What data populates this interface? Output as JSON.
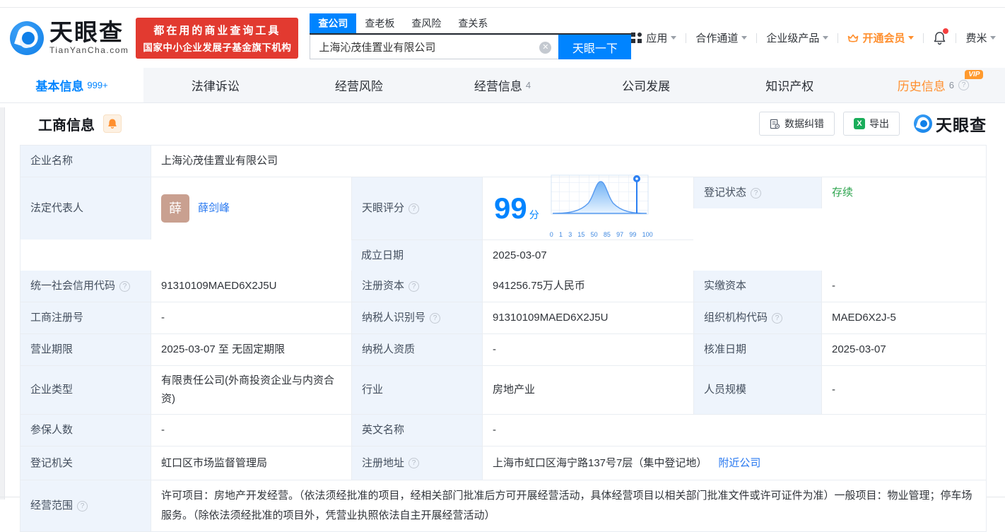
{
  "colors": {
    "accent": "#0084ff",
    "orange": "#ff8f2e",
    "green": "#2da44e",
    "promo_red": "#e23a30",
    "label_bg": "#eef4fc",
    "avatar_bg": "#c9a090"
  },
  "header": {
    "brand": "天眼查",
    "brand_domain": "TianYanCha.com",
    "promo": {
      "line1": "都在用的商业查询工具",
      "line2": "国家中小企业发展子基金旗下机构"
    },
    "search": {
      "tabs": {
        "company": "查公司",
        "boss": "查老板",
        "risk": "查风险",
        "relation": "查关系"
      },
      "value": "上海沁茂佳置业有限公司",
      "button": "天眼一下"
    },
    "nav": {
      "apps": "应用",
      "partner": "合作通道",
      "enterprise": "企业级产品",
      "vip": "开通会员",
      "user": "费米"
    }
  },
  "tabs": {
    "basic": {
      "label": "基本信息",
      "badge": "999+"
    },
    "legal": {
      "label": "法律诉讼"
    },
    "risk": {
      "label": "经营风险"
    },
    "operation": {
      "label": "经营信息",
      "badge": "4"
    },
    "development": {
      "label": "公司发展"
    },
    "ip": {
      "label": "知识产权"
    },
    "history": {
      "label": "历史信息",
      "badge": "6",
      "vip_tag": "VIP"
    }
  },
  "section": {
    "title": "工商信息",
    "correct_btn": "数据纠错",
    "export_btn": "导出",
    "brand": "天眼查"
  },
  "table": {
    "r1": {
      "label": "企业名称",
      "value": "上海沁茂佳置业有限公司"
    },
    "r2": {
      "label": "法定代表人",
      "avatar": "薛",
      "name": "薛剑峰",
      "status_label": "登记状态",
      "status_value": "存续",
      "date_label": "成立日期",
      "date_value": "2025-03-07",
      "score_label": "天眼评分"
    },
    "r3": {
      "l1": "统一社会信用代码",
      "v1": "91310109MAED6X2J5U",
      "l2": "注册资本",
      "v2": "941256.75万人民币",
      "l3": "实缴资本",
      "v3": "-"
    },
    "r4": {
      "l1": "工商注册号",
      "v1": "-",
      "l2": "纳税人识别号",
      "v2": "91310109MAED6X2J5U",
      "l3": "组织机构代码",
      "v3": "MAED6X2J-5"
    },
    "r5": {
      "l1": "营业期限",
      "v1": "2025-03-07 至 无固定期限",
      "l2": "纳税人资质",
      "v2": "-",
      "l3": "核准日期",
      "v3": "2025-03-07"
    },
    "r6": {
      "l1": "企业类型",
      "v1": "有限责任公司(外商投资企业与内资合资)",
      "l2": "行业",
      "v2": "房地产业",
      "l3": "人员规模",
      "v3": "-"
    },
    "r7": {
      "l1": "参保人数",
      "v1": "-",
      "l2": "英文名称",
      "v2": "-"
    },
    "r8": {
      "l1": "登记机关",
      "v1": "虹口区市场监督管理局",
      "l2": "注册地址",
      "v2": "上海市虹口区海宁路137号7层（集中登记地）",
      "link": "附近公司"
    },
    "r9": {
      "label": "经营范围",
      "value": "许可项目：房地产开发经营。（依法须经批准的项目，经相关部门批准后方可开展经营活动，具体经营项目以相关部门批准文件或许可证件为准）一般项目：物业管理；停车场服务。（除依法须经批准的项目外，凭营业执照依法自主开展经营活动）"
    }
  },
  "score": {
    "value": "99",
    "unit": "分",
    "ticks": [
      "0",
      "1",
      "3",
      "15",
      "50",
      "85",
      "97",
      "99",
      "100"
    ]
  }
}
